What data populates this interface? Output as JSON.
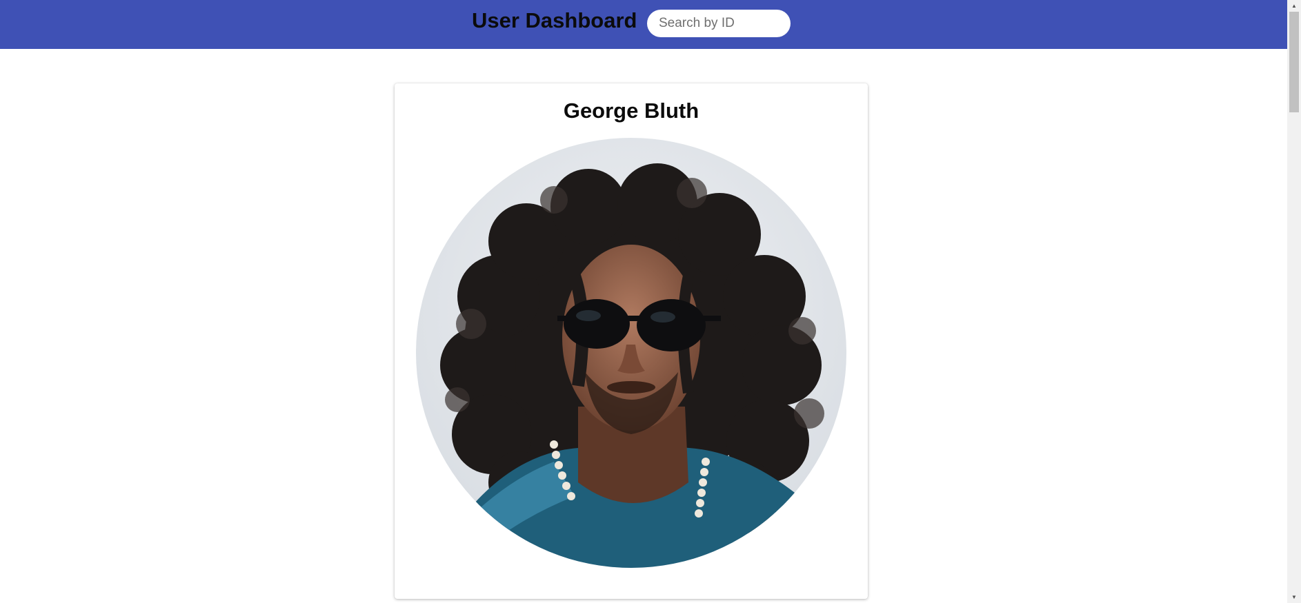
{
  "header": {
    "title": "User Dashboard",
    "background_color": "#3f51b5"
  },
  "search": {
    "placeholder": "Search by ID",
    "value": ""
  },
  "user": {
    "name": "George Bluth",
    "avatar_icon": "user-photo"
  }
}
